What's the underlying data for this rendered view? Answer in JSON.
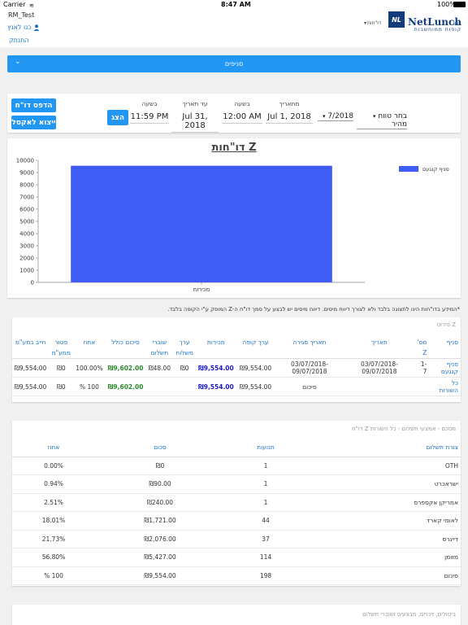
{
  "status_bar": {
    "carrier": "Carrier",
    "time": "8:47 AM",
    "battery": "100%"
  },
  "header": {
    "account_name": "RM_Test",
    "user_link": "כנו לאנץ",
    "logout": "התנתק",
    "reports_menu": "דו\"חות",
    "logo_text": "NetLunch",
    "logo_suffix": "ltd.",
    "logo_tagline": "קופות ממוחשבות",
    "logo_badge": "NL"
  },
  "branches_bar": {
    "label": "סניפים"
  },
  "filters": {
    "range_select": "בחר טווח מהיר",
    "month_select": "7/2018",
    "from_date_label": "מתאריך",
    "from_date": "Jul 1, 2018",
    "from_time_label": "בשעה",
    "from_time": "12:00 AM",
    "to_date_label": "עד תאריך",
    "to_date": "Jul 31, 2018",
    "to_time_label": "בשעה",
    "to_time": "11:59 PM",
    "show_button": "הצג",
    "print_button": "הדפס דו\"ח",
    "excel_button": "ייצוא לאקסל"
  },
  "report": {
    "title": "דו\"חות Z",
    "note": "*המידע בדו\"חות הינו לתצוגה בלבד ולא לצורך דיווח מיסים. דיווח מיסים יש לבצע על סמך דו\"ח ה-Z המופק ע\"י הקופה בלבד."
  },
  "chart_data": {
    "type": "bar",
    "categories": [
      "מכירות"
    ],
    "series": [
      {
        "name": "סניף קנגעם",
        "values": [
          9554
        ]
      }
    ],
    "ylim": [
      0,
      10000
    ],
    "yticks": [
      "0",
      "1000",
      "2000",
      "3000",
      "4000",
      "5000",
      "6000",
      "7000",
      "8000",
      "9000",
      "10000"
    ],
    "legend": "top-right",
    "grid": false,
    "bar_color": "#3f5cf5"
  },
  "z_table": {
    "title": "פירוט Z",
    "headers": [
      "סניף",
      "מס' Z",
      "תאריך",
      "תאריך סגירה",
      "ערך קופה",
      "מכירות",
      "ערך משלוח",
      "שוברי תשלום",
      "סיכום כולל",
      "אחוז",
      "פטור ממע\"מ",
      "חייב במע\"מ"
    ],
    "rows": [
      {
        "branch": "סניף קנגעם",
        "z": "1-7",
        "date": "03/07/2018-09/07/2018",
        "close_date": "03/07/2018-09/07/2018",
        "register": "₪9,554.00",
        "sales": "₪9,554.00",
        "delivery": "₪0",
        "vouchers": "₪48.00",
        "total": "₪9,602.00",
        "percent": "100.00%",
        "exempt": "₪0",
        "taxable": "₪9,554.00"
      }
    ],
    "total_row": {
      "branch": "כל השורות",
      "label": "סיכום",
      "register": "₪9,554.00",
      "sales": "₪9,554.00",
      "total": "₪9,602.00",
      "percent": "100 %",
      "exempt": "₪0",
      "taxable": "₪9,554.00"
    }
  },
  "payments_table": {
    "title": "דו\"ח Z מסכם - אמצעי תשלום - כל השורות",
    "headers": [
      "צורת תשלום",
      "תנועות",
      "סכום",
      "אחוז"
    ],
    "rows": [
      {
        "method": "OTH",
        "count": "1",
        "amount": "₪0",
        "percent": "0.00%"
      },
      {
        "method": "ישראכרט",
        "count": "1",
        "amount": "₪90.00",
        "percent": "0.94%"
      },
      {
        "method": "אמריקן אקספרס",
        "count": "1",
        "amount": "₪240.00",
        "percent": "2.51%"
      },
      {
        "method": "לאומי קארד",
        "count": "44",
        "amount": "₪1,721.00",
        "percent": "18.01%"
      },
      {
        "method": "דיינרס",
        "count": "37",
        "amount": "₪2,076.00",
        "percent": "21.73%"
      },
      {
        "method": "מזומן",
        "count": "114",
        "amount": "₪5,427.00",
        "percent": "56.80%"
      },
      {
        "method": "סיכום",
        "count": "198",
        "amount": "₪9,554.00",
        "percent": "100 %"
      }
    ]
  },
  "bottom_panel": {
    "title": "ביטולים, זיכויים, מבצעים ושוברי תשלום"
  }
}
